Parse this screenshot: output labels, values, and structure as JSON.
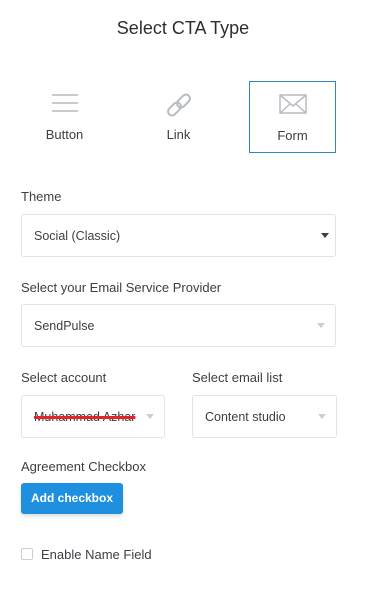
{
  "header": {
    "title": "Select CTA Type"
  },
  "cta_types": [
    {
      "label": "Button",
      "icon": "hamburger-lines-icon",
      "selected": false
    },
    {
      "label": "Link",
      "icon": "chain-link-icon",
      "selected": false
    },
    {
      "label": "Form",
      "icon": "envelope-icon",
      "selected": true
    }
  ],
  "theme": {
    "label": "Theme",
    "value": "Social (Classic)"
  },
  "provider": {
    "label": "Select your Email Service Provider",
    "value": "SendPulse"
  },
  "account": {
    "label": "Select account",
    "value": "Muhammad Azhar"
  },
  "email_list": {
    "label": "Select email list",
    "value": "Content studio"
  },
  "agreement": {
    "label": "Agreement Checkbox",
    "button_label": "Add checkbox"
  },
  "name_field": {
    "label": "Enable Name Field",
    "checked": false
  },
  "colors": {
    "accent": "#1f8fe0",
    "selected_border": "#2f86b8",
    "icon_gray": "#b6bcc2",
    "redaction": "#e0262a"
  }
}
